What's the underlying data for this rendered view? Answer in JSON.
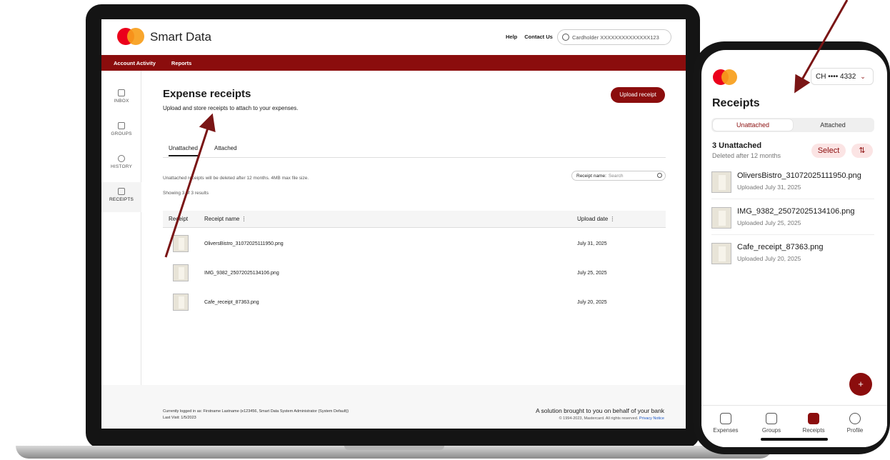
{
  "colors": {
    "brand_red": "#8b0d0d",
    "mc_red": "#eb001b",
    "mc_orange": "#f79e1b",
    "arrow": "#7a1515"
  },
  "desktop": {
    "brand": "Smart Data",
    "top_links": {
      "help": "Help",
      "contact": "Contact Us"
    },
    "cardholder": "Cardholder XXXXXXXXXXXXXX123",
    "nav": [
      "Account Activity",
      "Reports"
    ],
    "sidenav": [
      {
        "label": "INBOX",
        "icon": "inbox-icon"
      },
      {
        "label": "GROUPS",
        "icon": "layers-icon"
      },
      {
        "label": "HISTORY",
        "icon": "history-icon"
      },
      {
        "label": "RECEIPTS",
        "icon": "receipt-icon"
      }
    ],
    "page": {
      "title": "Expense receipts",
      "subtitle": "Upload and store receipts to attach to your expenses.",
      "upload_label": "Upload receipt",
      "tabs": [
        "Unattached",
        "Attached"
      ],
      "notice": "Unattached receipts will be deleted after 12 months. 4MB max file size.",
      "showing": "Showing 3 of 3 results",
      "search_label": "Receipt name:",
      "search_placeholder": "Search",
      "columns": {
        "receipt": "Receipt",
        "name": "Receipt name",
        "date": "Upload date"
      },
      "rows": [
        {
          "name": "OliversBistro_31072025111950.png",
          "date": "July 31, 2025"
        },
        {
          "name": "IMG_9382_25072025134106.png",
          "date": "July 25, 2025"
        },
        {
          "name": "Cafe_receipt_87363.png",
          "date": "July 20, 2025"
        }
      ]
    },
    "footer": {
      "logged_in": "Currently logged in as: Firstname Lastname (e123456, Smart Data System Administrator (System Default))",
      "last_visit": "Last Visit: 1/5/2023",
      "tagline": "A solution brought to you on behalf of your bank",
      "copyright": "© 1994-2023, Mastercard. All rights reserved.",
      "privacy": "Privacy Notice"
    }
  },
  "mobile": {
    "card": "CH •••• 4332",
    "title": "Receipts",
    "tabs": [
      "Unattached",
      "Attached"
    ],
    "count": "3 Unattached",
    "deleted_note": "Deleted after 12 months",
    "select_label": "Select",
    "sort_glyph": "⇅",
    "rows": [
      {
        "name": "OliversBistro_31072025111950.png",
        "uploaded": "Uploaded July 31, 2025"
      },
      {
        "name": "IMG_9382_25072025134106.png",
        "uploaded": "Uploaded July 25, 2025"
      },
      {
        "name": "Cafe_receipt_87363.png",
        "uploaded": "Uploaded July 20, 2025"
      }
    ],
    "fab_glyph": "+",
    "tabbar": [
      "Expenses",
      "Groups",
      "Receipts",
      "Profile"
    ]
  }
}
